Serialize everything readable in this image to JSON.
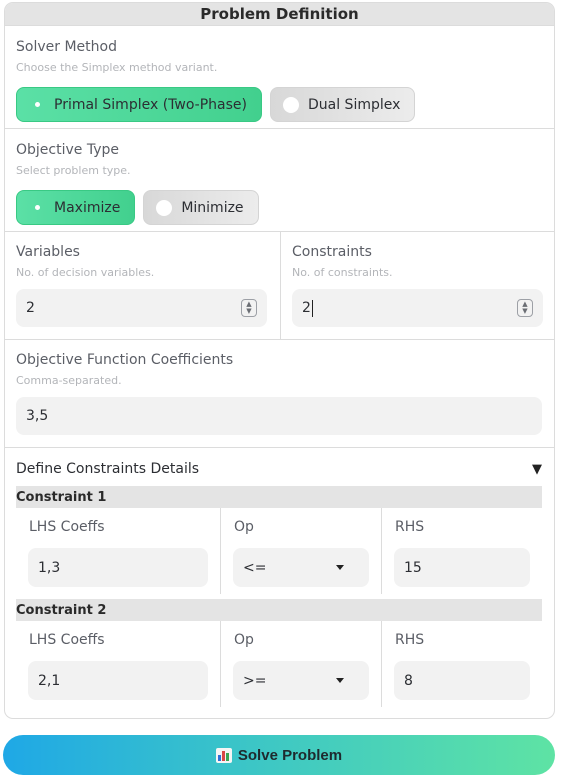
{
  "panel": {
    "title": "Problem Definition"
  },
  "solver": {
    "label": "Solver Method",
    "help": "Choose the Simplex method variant.",
    "options": [
      "Primal Simplex (Two-Phase)",
      "Dual Simplex"
    ],
    "selected": "Primal Simplex (Two-Phase)"
  },
  "objective": {
    "label": "Objective Type",
    "help": "Select problem type.",
    "options": [
      "Maximize",
      "Minimize"
    ],
    "selected": "Maximize"
  },
  "variables": {
    "label": "Variables",
    "help": "No. of decision variables.",
    "value": "2"
  },
  "constraints": {
    "label": "Constraints",
    "help": "No. of constraints.",
    "value": "2"
  },
  "coefficients": {
    "label": "Objective Function Coefficients",
    "help": "Comma-separated.",
    "value": "3,5"
  },
  "details": {
    "title": "Define Constraints Details",
    "toggle_icon": "▼",
    "col_lhs": "LHS Coeffs",
    "col_op": "Op",
    "col_rhs": "RHS",
    "rows": [
      {
        "title": "Constraint 1",
        "lhs": "1,3",
        "op": "<=",
        "rhs": "15"
      },
      {
        "title": "Constraint 2",
        "lhs": "2,1",
        "op": ">=",
        "rhs": "8"
      }
    ]
  },
  "solve_button": {
    "label": "Solve Problem",
    "icon": "bar-chart-icon"
  },
  "colors": {
    "accent_green": "#42d08e",
    "accent_blue": "#1fa8e6"
  }
}
